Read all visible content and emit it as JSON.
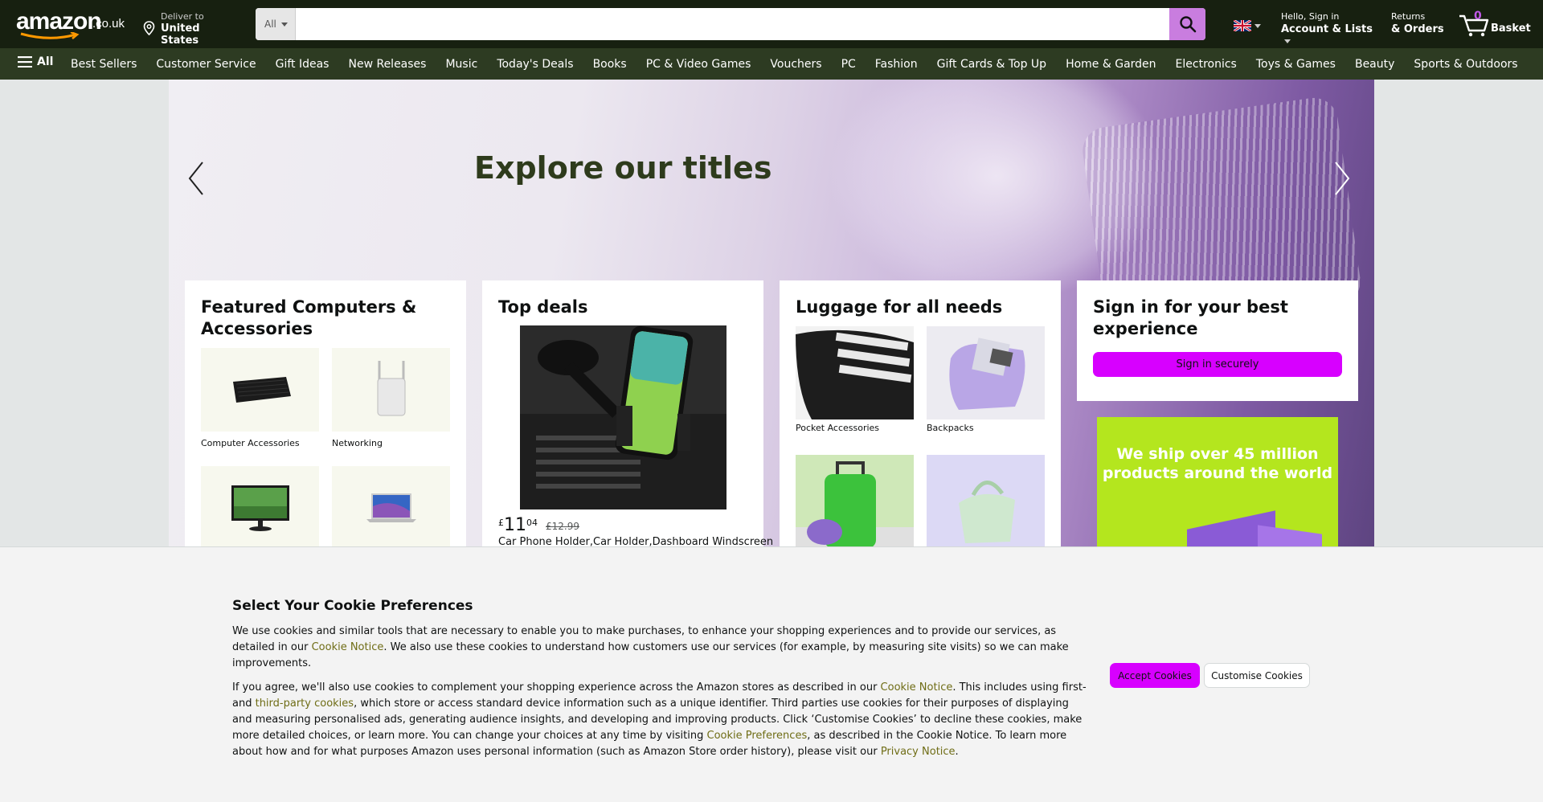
{
  "header": {
    "logo_brand": "amazon",
    "logo_tld": ".co.uk",
    "deliver_line1": "Deliver to",
    "deliver_line2": "United States",
    "search_category": "All",
    "search_placeholder": "",
    "account_line1": "Hello, Sign in",
    "account_line2": "Account & Lists",
    "returns_line1": "Returns",
    "returns_line2": "& Orders",
    "basket_count": "0",
    "basket_label": "Basket",
    "flag_icon": "uk-flag-icon"
  },
  "subnav": {
    "all_label": "All",
    "items": [
      "Best Sellers",
      "Customer Service",
      "Gift Ideas",
      "New Releases",
      "Music",
      "Today's Deals",
      "Books",
      "PC & Video Games",
      "Vouchers",
      "PC",
      "Fashion",
      "Gift Cards & Top Up",
      "Home & Garden",
      "Electronics",
      "Toys & Games",
      "Beauty",
      "Sports & Outdoors"
    ]
  },
  "hero": {
    "title": "Explore our titles"
  },
  "cards": {
    "computers": {
      "title": "Featured Computers & Accessories",
      "tiles": [
        "Computer Accessories",
        "Networking",
        "",
        ""
      ]
    },
    "deals": {
      "title": "Top deals",
      "price_currency": "£",
      "price_main": "11",
      "price_fraction": "04",
      "price_was": "£12.99",
      "product_title": "Car Phone Holder,Car Holder,Dashboard Windscreen"
    },
    "luggage": {
      "title": "Luggage for all needs",
      "tiles": [
        "Pocket Accessories",
        "Backpacks",
        "",
        ""
      ]
    },
    "signin": {
      "title": "Sign in for your best experience",
      "button": "Sign in securely"
    },
    "promo": {
      "text": "We ship over 45 million products around the world"
    }
  },
  "cookie": {
    "title": "Select Your Cookie Preferences",
    "p1_a": "We use cookies and similar tools that are necessary to enable you to make purchases, to enhance your shopping experiences and to provide our services, as detailed in our ",
    "p1_link": "Cookie Notice",
    "p1_b": ". We also use these cookies to understand how customers use our services (for example, by measuring site visits) so we can make improvements.",
    "p2_a": "If you agree, we'll also use cookies to complement your shopping experience across the Amazon stores as described in our ",
    "p2_link1": "Cookie Notice",
    "p2_b": ". This includes using first- and ",
    "p2_link2": "third-party cookies",
    "p2_c": ", which store or access standard device information such as a unique identifier. Third parties use cookies for their purposes of displaying and measuring personalised ads, generating audience insights, and developing and improving products. Click ‘Customise Cookies’ to decline these cookies, make more detailed choices, or learn more. You can change your choices at any time by visiting ",
    "p2_link3": "Cookie Preferences",
    "p2_d": ", as described in the Cookie Notice. To learn more about how and for what purposes Amazon uses personal information (such as Amazon Store order history), please visit our ",
    "p2_link4": "Privacy Notice",
    "p2_e": ".",
    "accept_button": "Accept Cookies",
    "customise_button": "Customise Cookies"
  },
  "colors": {
    "nav_top": "#172010",
    "nav_sub": "#2d3b22",
    "accent": "#d700ff",
    "search_button": "#c97ddf",
    "link": "#6f6d16"
  }
}
